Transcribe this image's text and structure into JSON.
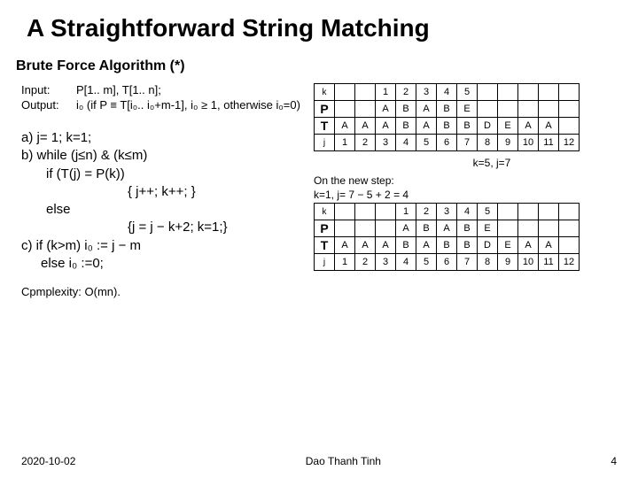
{
  "title": "A Straightforward String Matching",
  "subtitle": "Brute Force Algorithm (*)",
  "io": {
    "input_label": "Input:",
    "input_val": "P[1.. m], T[1.. n];",
    "output_label": "Output:",
    "output_val": "i₀ (if P ≡ T[i₀.. i₀+m-1], i₀ ≥ 1, otherwise i₀=0)"
  },
  "steps": {
    "a": "a) j= 1;  k=1;",
    "b": "b) while (j≤n) & (k≤m)",
    "b_if": "if  (T(j) = P(k))",
    "b_then": "{ j++; k++; }",
    "b_else": "else",
    "b_else_body": "{j = j − k+2; k=1;}",
    "c": "c) if  (k>m)  i₀ := j − m",
    "c_else": "else     i₀ :=0;"
  },
  "complexity": "Cpmplexity:   O(mn).",
  "table1": {
    "k_label": "k",
    "k_vals": [
      "",
      "",
      "1",
      "2",
      "3",
      "4",
      "5",
      "",
      "",
      "",
      "",
      ""
    ],
    "P_label": "P",
    "P_vals": [
      "",
      "",
      "A",
      "B",
      "A",
      "B",
      "E",
      "",
      "",
      "",
      "",
      ""
    ],
    "T_label": "T",
    "T_vals": [
      "A",
      "A",
      "A",
      "B",
      "A",
      "B",
      "B",
      "D",
      "E",
      "A",
      "A",
      ""
    ],
    "j_label": "j",
    "j_vals": [
      "1",
      "2",
      "3",
      "4",
      "5",
      "6",
      "7",
      "8",
      "9",
      "10",
      "11",
      "12"
    ]
  },
  "mid_note": "k=5, j=7",
  "step_note1": "On the new step:",
  "step_note2": "k=1, j= 7 − 5 + 2 = 4",
  "table2": {
    "k_label": "k",
    "k_vals": [
      "",
      "",
      "",
      "1",
      "2",
      "3",
      "4",
      "5",
      "",
      "",
      "",
      ""
    ],
    "P_label": "P",
    "P_vals": [
      "",
      "",
      "",
      "A",
      "B",
      "A",
      "B",
      "E",
      "",
      "",
      "",
      ""
    ],
    "T_label": "T",
    "T_vals": [
      "A",
      "A",
      "A",
      "B",
      "A",
      "B",
      "B",
      "D",
      "E",
      "A",
      "A",
      ""
    ],
    "j_label": "j",
    "j_vals": [
      "1",
      "2",
      "3",
      "4",
      "5",
      "6",
      "7",
      "8",
      "9",
      "10",
      "11",
      "12"
    ]
  },
  "footer": {
    "date": "2020-10-02",
    "author": "Dao Thanh Tinh",
    "page": "4"
  }
}
